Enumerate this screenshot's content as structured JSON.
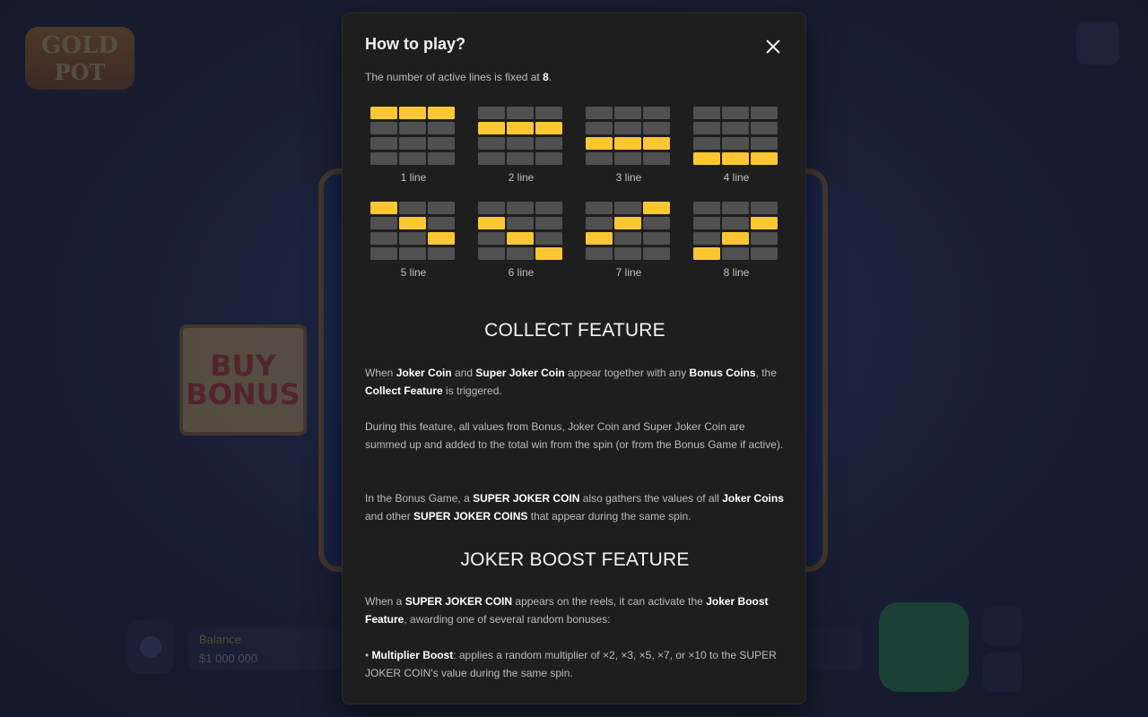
{
  "background": {
    "logo_line1": "GOLD",
    "logo_line2": "POT",
    "buy_bonus_line1": "BUY",
    "buy_bonus_line2": "BONUS",
    "balance_label": "Balance",
    "balance_value": "$1 000 000"
  },
  "modal": {
    "title": "How to play?",
    "lines_intro": {
      "text": "The number of active lines is fixed at ",
      "count": "8",
      "end": "."
    },
    "colors": {
      "active_cell": "#fdc734",
      "inactive_cell": "#505050"
    },
    "paylines": [
      {
        "label": "1 line",
        "rows": [
          0,
          0,
          0
        ]
      },
      {
        "label": "2 line",
        "rows": [
          1,
          1,
          1
        ]
      },
      {
        "label": "3 line",
        "rows": [
          2,
          2,
          2
        ]
      },
      {
        "label": "4 line",
        "rows": [
          3,
          3,
          3
        ]
      },
      {
        "label": "5 line",
        "rows": [
          0,
          1,
          2
        ]
      },
      {
        "label": "6 line",
        "rows": [
          1,
          2,
          3
        ]
      },
      {
        "label": "7 line",
        "rows": [
          2,
          1,
          0
        ]
      },
      {
        "label": "8 line",
        "rows": [
          3,
          2,
          1
        ]
      }
    ],
    "collect": {
      "title": "COLLECT FEATURE",
      "p1": {
        "a": "When ",
        "b": "Joker Coin",
        "c": " and ",
        "d": "Super Joker Coin",
        "e": " appear together with any ",
        "f": "Bonus Coins",
        "g": ", the ",
        "h": "Collect Feature",
        "i": " is triggered."
      },
      "p2": "During this feature, all values from Bonus, Joker Coin and Super Joker Coin are summed up and added to the total win from the spin (or from the Bonus Game if active).",
      "p3": {
        "a": "In the Bonus Game, a ",
        "b": "SUPER JOKER COIN",
        "c": " also gathers the values of all ",
        "d": "Joker Coins",
        "e": " and other ",
        "f": "SUPER JOKER COINS",
        "g": " that appear during the same spin."
      }
    },
    "boost": {
      "title": "JOKER BOOST FEATURE",
      "p1": {
        "a": "When a ",
        "b": "SUPER JOKER COIN",
        "c": " appears on the reels, it can activate the ",
        "d": "Joker Boost Feature",
        "e": ", awarding one of several random bonuses:"
      },
      "bullet1": {
        "a": "• ",
        "b": "Multiplier Boost",
        "c": ": applies a random multiplier of ×2, ×3, ×5, ×7, or ×10 to the SUPER JOKER COIN's value during the same spin."
      }
    }
  }
}
